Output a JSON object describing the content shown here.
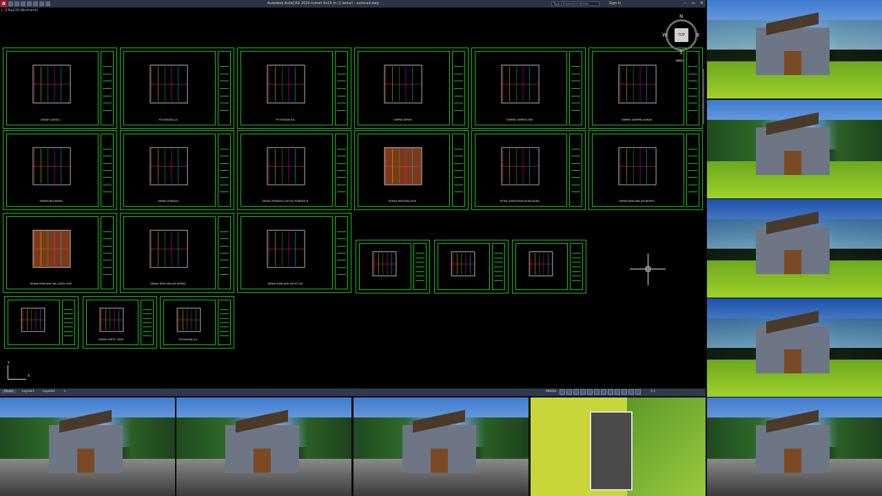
{
  "window": {
    "title": "Autodesk AutoCAD 2020   rumah 9x15 m (1 lantai) - autocad.dwg",
    "search_placeholder": "Type a keyword or phrase",
    "sign_in": "Sign In"
  },
  "viewport": {
    "label": "[−][Top][2D Wireframe]"
  },
  "viewcube": {
    "face": "TOP",
    "north": "N",
    "south": "S",
    "east": "E",
    "west": "W",
    "wcs": "WCS"
  },
  "ucs": {
    "x": "X",
    "y": "Y"
  },
  "sheets": [
    {
      "label": "DENAH LANTAI 1"
    },
    {
      "label": "POTONGAN A-A"
    },
    {
      "label": "POTONGAN B-B"
    },
    {
      "label": "TAMPAK DEPAN"
    },
    {
      "label": "TAMPAK SAMPING KIRI"
    },
    {
      "label": "TAMPAK SAMPING KANAN"
    },
    {
      "label": "TAMPAK BELAKANG"
    },
    {
      "label": "DENAH PONDASI"
    },
    {
      "label": "DETAIL PONDASI A   DETAIL PONDASI B"
    },
    {
      "label": "DENAH RENCANA ATAP"
    },
    {
      "label": "DETAIL KONSTRUKSI KUDA-KUDA"
    },
    {
      "label": "DENAH RENCANA AIR BERSIH"
    },
    {
      "label": "DENAH RENCANA AIR LANTAI ATAP"
    },
    {
      "label": "DENAH RENCANA AIR BERSIH"
    },
    {
      "label": "DENAH RENCANA AIR KOTOR"
    },
    {
      "label": ""
    },
    {
      "label": ""
    },
    {
      "label": ""
    },
    {
      "label": ""
    },
    {
      "label": "DENAH SEPTIC TANK"
    },
    {
      "label": "POTONGAN A-A"
    }
  ],
  "statusbar": {
    "tabs": [
      "Model",
      "Layout1",
      "Layout2",
      "+"
    ],
    "model_label": "MODEL",
    "scale": "1:1"
  },
  "renders": [
    {
      "name": "render-back-view"
    },
    {
      "name": "render-front-angle"
    },
    {
      "name": "render-side-evening"
    },
    {
      "name": "render-back-evening"
    },
    {
      "name": "render-street-front-car"
    },
    {
      "name": "render-street-front-angle"
    },
    {
      "name": "render-street-front-cyclist"
    },
    {
      "name": "render-aerial-top"
    },
    {
      "name": "render-street-front-gate"
    }
  ],
  "colors": {
    "cad_background": "#000000",
    "sheet_border": "#19c419",
    "ui_bar": "#2e3a4a",
    "autocad_red": "#c8102e"
  }
}
